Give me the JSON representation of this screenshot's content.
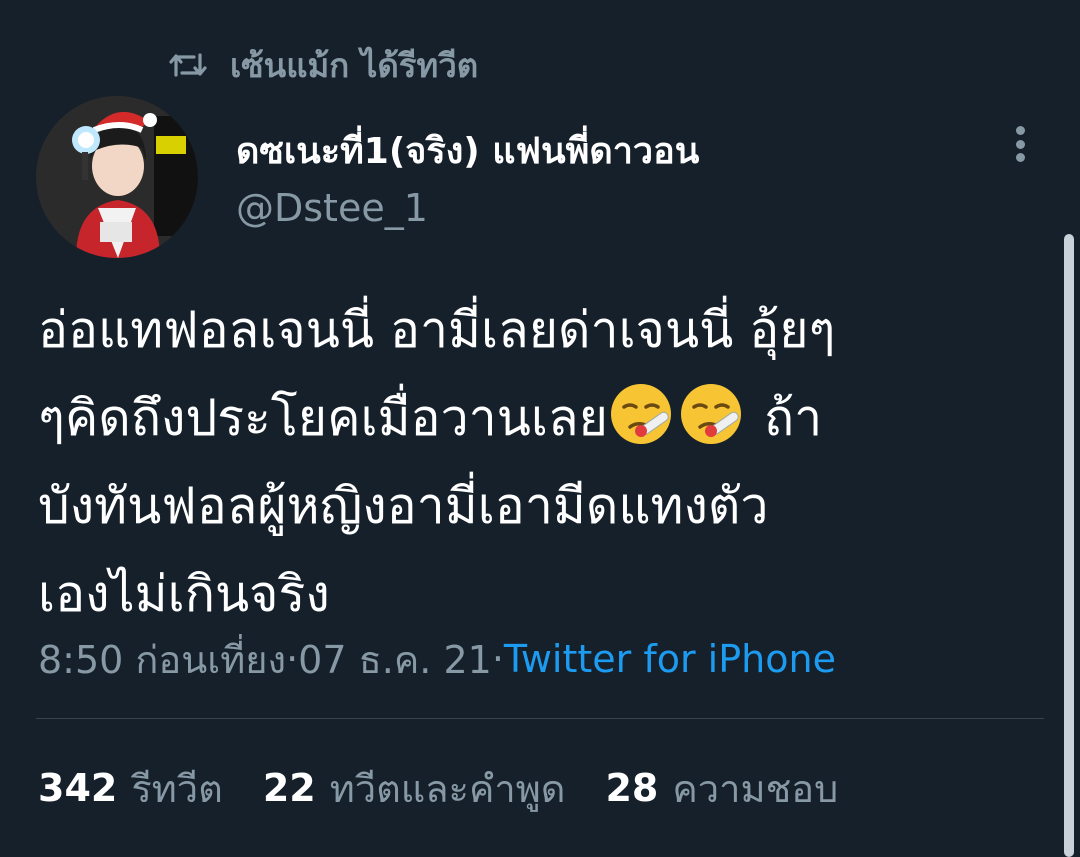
{
  "retweet_context": {
    "icon": "retweet-icon",
    "text": "เซ้นแม้ก ได้รีทวีต"
  },
  "author": {
    "display_name": "ดซเนะที่1(จริง) แฟนพี่ดาวอน",
    "handle": "@Dstee_1"
  },
  "tweet": {
    "lines": [
      "อ่อแทฟอลเจนนี่ อามี่เลยด่าเจนนี่ อุ้ยๆ",
      "ๆคิดถึงประโยคเมื่อวานเลย",
      " ถ้า",
      "บังทันฟอลผู้หญิงอามี่เอามีดแทงตัว",
      "เองไม่เกินจริง"
    ],
    "emoji": "face-with-thermometer"
  },
  "meta": {
    "time": "8:50 ก่อนเที่ยง",
    "separator": " · ",
    "date": "07 ธ.ค. 21",
    "source": "Twitter for iPhone"
  },
  "stats": {
    "retweets": {
      "count": "342",
      "label": "รีทวีต"
    },
    "quotes": {
      "count": "22",
      "label": "ทวีตและคำพูด"
    },
    "likes": {
      "count": "28",
      "label": "ความชอบ"
    }
  },
  "colors": {
    "background": "#15202b",
    "secondary_text": "#8899a6",
    "link": "#1d9bf0",
    "divider": "#38444d"
  }
}
